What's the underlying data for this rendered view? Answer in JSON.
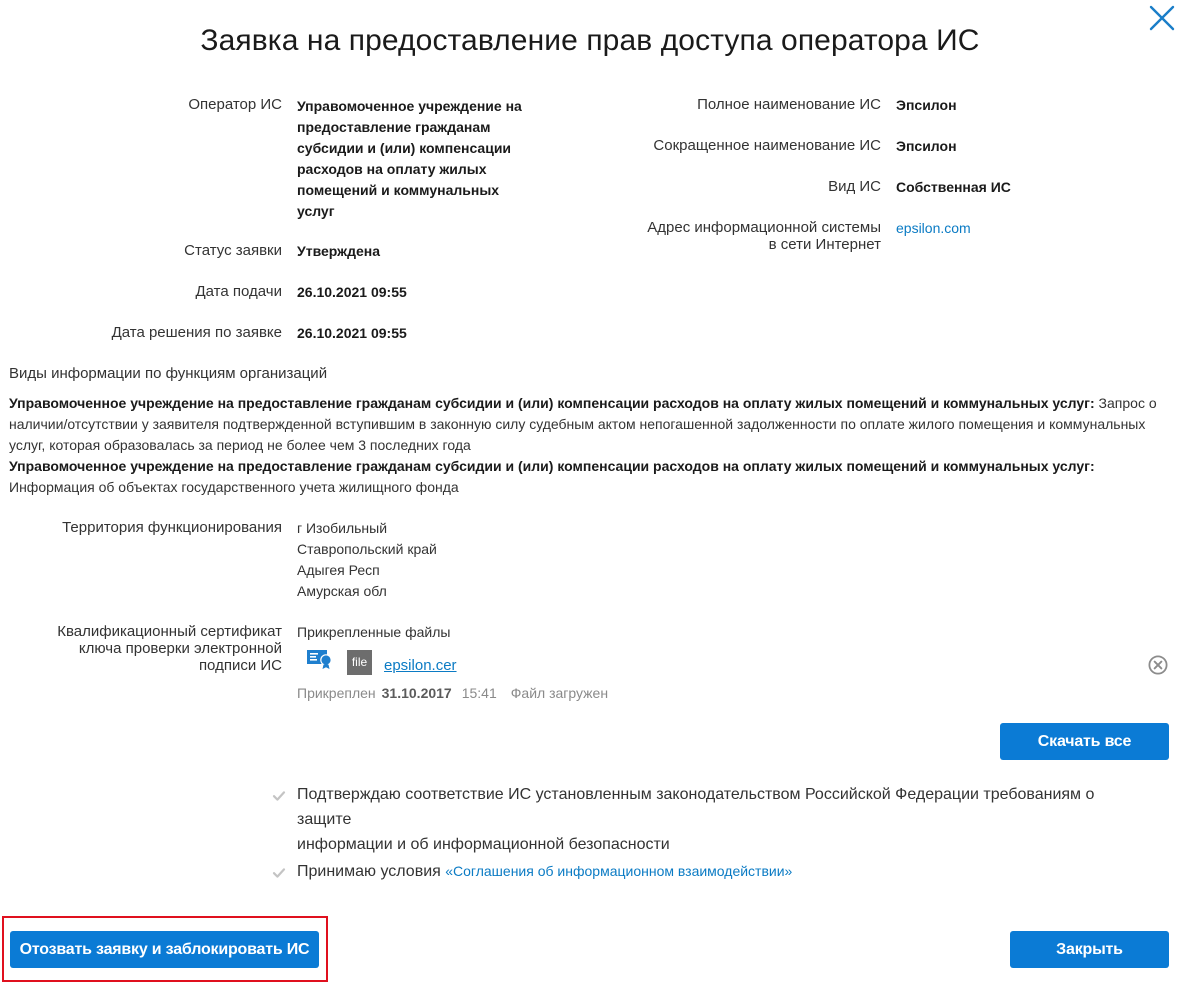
{
  "dialog": {
    "title": "Заявка на предоставление прав доступа оператора ИС",
    "close_icon": "close-icon"
  },
  "left_fields": {
    "operator_label": "Оператор ИС",
    "operator_value_lines": [
      "Управомоченное учреждение на",
      "предоставление гражданам",
      "субсидии и (или) компенсации",
      "расходов на оплату жилых",
      "помещений и коммунальных",
      "услуг"
    ],
    "status_label": "Статус заявки",
    "status_value": "Утверждена",
    "submit_date_label": "Дата подачи",
    "submit_date_value": "26.10.2021 09:55",
    "decision_date_label": "Дата решения по заявке",
    "decision_date_value": "26.10.2021 09:55"
  },
  "right_fields": {
    "full_name_label": "Полное наименование ИС",
    "full_name_value": "Эпсилон",
    "short_name_label": "Сокращенное наименование ИС",
    "short_name_value": "Эпсилон",
    "type_label": "Вид ИС",
    "type_value": "Собственная ИС",
    "address_label_line1": "Адрес информационной системы",
    "address_label_line2": "в сети Интернет",
    "address_value": "epsilon.com"
  },
  "info_types": {
    "section_title": "Виды информации по функциям организаций",
    "entries": [
      {
        "org_bold": "Управомоченное учреждение на предоставление гражданам субсидии и (или) компенсации расходов на оплату жилых помещений и коммунальных услуг:",
        "text": " Запрос о наличии/отсутствии у заявителя подтвержденной вступившим в законную силу судебным актом непогашенной задолженности по оплате жилого помещения и коммунальных услуг, которая образовалась за период не более чем 3 последних года"
      },
      {
        "org_bold": "Управомоченное учреждение на предоставление гражданам субсидии и (или) компенсации расходов на оплату жилых помещений и коммунальных услуг:",
        "text": " Информация об объектах государственного учета жилищного фонда"
      }
    ]
  },
  "territory": {
    "label": "Территория функционирования",
    "items": [
      "г Изобильный",
      "Ставропольский край",
      "Адыгея Респ",
      "Амурская обл"
    ]
  },
  "certificate": {
    "label_lines": [
      "Квалификационный сертификат",
      "ключа проверки электронной",
      "подписи ИС"
    ],
    "attached_heading": "Прикрепленные файлы",
    "file_icon_text": "file",
    "file_name": "epsilon.cer",
    "attached_prefix": "Прикреплен",
    "attached_date": "31.10.2017",
    "attached_time": "15:41",
    "upload_status": "Файл загружен",
    "download_all_label": "Скачать все"
  },
  "confirmations": {
    "compliance_line1": "Подтверждаю соответствие ИС установленным законодательством Российской Федерации требованиям о защите",
    "compliance_line2": "информации и об информационной безопасности",
    "compliance_checked": true,
    "terms_prefix": "Принимаю условия",
    "terms_link": "«Соглашения об информационном взаимодействии»",
    "terms_checked": true
  },
  "footer": {
    "revoke_label": "Отозвать заявку и заблокировать ИС",
    "close_label": "Закрыть"
  },
  "colors": {
    "primary": "#0b7bd5",
    "link": "#0b7bc4",
    "highlight": "#e0101e"
  }
}
